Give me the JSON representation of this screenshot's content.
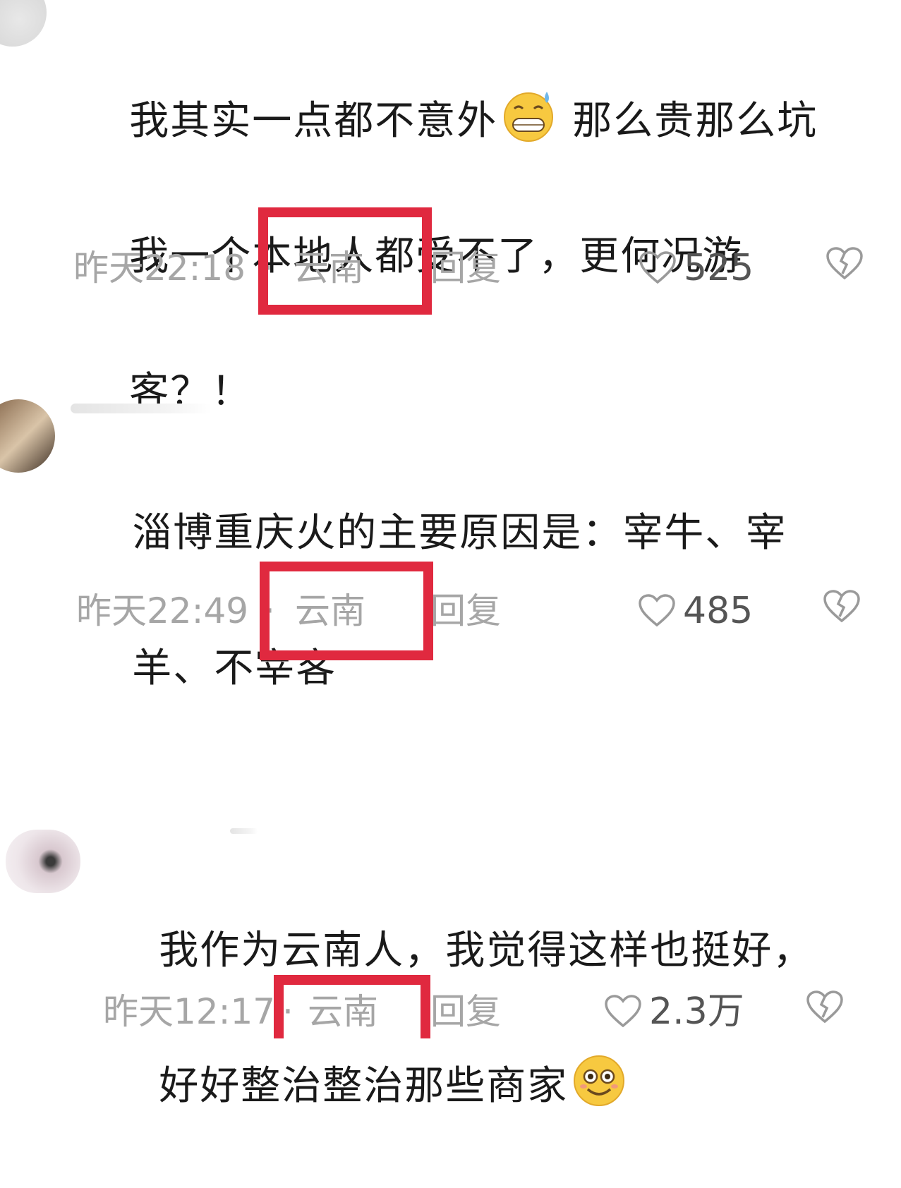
{
  "colors": {
    "highlight": "#e0293f",
    "meta_text": "#a6a6a6",
    "body_text": "#1a1a1a"
  },
  "comments": [
    {
      "lines": [
        "我其实一点都不意外",
        "那么贵那么坑",
        "我一个本地人都受不了，更何况游",
        "客？！"
      ],
      "emoji": "grinning-sweat-emoji",
      "time": "昨天22:18",
      "separator": "·",
      "location": "云南",
      "reply": "回复",
      "likes": "525"
    },
    {
      "lines": [
        "淄博重庆火的主要原因是：宰牛、宰",
        "羊、不宰客"
      ],
      "time": "昨天22:49",
      "separator": "·",
      "location": "云南",
      "reply": "回复",
      "likes": "485"
    },
    {
      "lines": [
        "我作为云南人，我觉得这样也挺好，",
        "好好整治整治那些商家"
      ],
      "emoji": "smiling-face-emoji",
      "time": "昨天12:17",
      "separator": "·",
      "location": "云南",
      "reply": "回复",
      "likes": "2.3万"
    }
  ]
}
